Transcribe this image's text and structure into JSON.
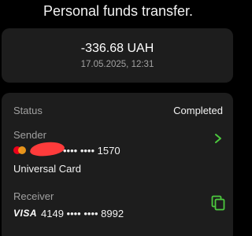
{
  "title": "Personal funds transfer.",
  "amount": "-336.68 UAH",
  "datetime": "17.05.2025, 12:31",
  "status": {
    "label": "Status",
    "value": "Completed"
  },
  "sender": {
    "label": "Sender",
    "card_masked": "•••• •••• 1570",
    "card_name": "Universal Card",
    "icon": "mastercard-icon"
  },
  "receiver": {
    "label": "Receiver",
    "brand": "VISA",
    "card_number": "4149 •••• •••• 8992",
    "icon": "visa-icon"
  },
  "colors": {
    "background": "#000000",
    "card": "#1d1d1d",
    "accent": "#4cc93e",
    "muted_text": "#a0a0a0"
  }
}
